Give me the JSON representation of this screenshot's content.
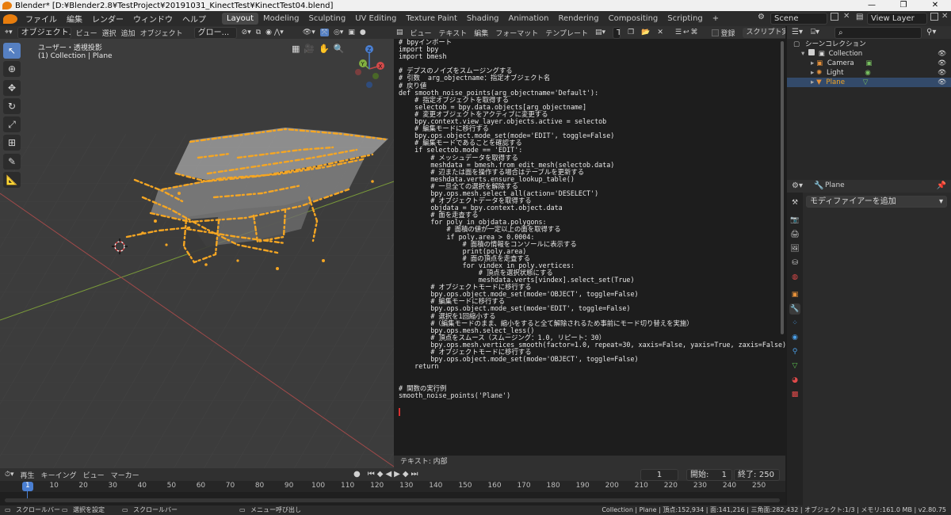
{
  "window": {
    "title": "Blender* [D:¥Blender2.8¥TestProject¥20191031_KinectTest¥KinectTest04.blend]",
    "controls": [
      "—",
      "❐",
      "✕"
    ]
  },
  "menubar": {
    "menus": [
      "ファイル",
      "編集",
      "レンダー",
      "ウィンドウ",
      "ヘルプ"
    ],
    "workspaces": [
      "Layout",
      "Modeling",
      "Sculpting",
      "UV Editing",
      "Texture Paint",
      "Shading",
      "Animation",
      "Rendering",
      "Compositing",
      "Scripting"
    ],
    "active_workspace": "Layout",
    "add_tab": "+",
    "scene": "Scene",
    "view_layer": "View Layer"
  },
  "viewport": {
    "mode": "オブジェクト...",
    "menus": [
      "ビュー",
      "選択",
      "追加",
      "オブジェクト"
    ],
    "transform": "グロー...",
    "view_name": "ユーザー・透視投影",
    "collection_info": "(1) Collection | Plane",
    "gizmo_axes": [
      "X",
      "Y",
      "Z"
    ]
  },
  "text_editor": {
    "menus": [
      "ビュー",
      "テキスト",
      "編集",
      "フォーマット",
      "テンプレート"
    ],
    "text_name": "Text",
    "register_label": "登録",
    "run_script": "スクリプト実行",
    "footer": "テキスト: 内部",
    "code_lines": [
      "# bpyインポート",
      "import bpy",
      "import bmesh",
      "",
      "# デプスのノイズをスムージングする",
      "# 引数  arg_objectname：指定オブジェクト名",
      "# 戻り値",
      "def smooth_noise_points(arg_objectname='Default'):",
      "    # 指定オブジェクトを取得する",
      "    selectob = bpy.data.objects[arg_objectname]",
      "    # 変更オブジェクトをアクティブに変更する",
      "    bpy.context.view_layer.objects.active = selectob",
      "    # 編集モードに移行する",
      "    bpy.ops.object.mode_set(mode='EDIT', toggle=False)",
      "    # 編集モードであることを確認する",
      "    if selectob.mode == 'EDIT':",
      "        # メッシュデータを取得する",
      "        meshdata = bmesh.from_edit_mesh(selectob.data)",
      "        # 辺または面を操作する場合はテーブルを更新する",
      "        meshdata.verts.ensure_lookup_table()",
      "        # 一旦全ての選択を解除する",
      "        bpy.ops.mesh.select_all(action='DESELECT')",
      "        # オブジェクトデータを取得する",
      "        objdata = bpy.context.object.data",
      "        # 面を走査する",
      "        for poly in objdata.polygons:",
      "            # 面積の値が一定以上の面を取得する",
      "            if poly.area > 0.0004:",
      "                # 面積の情報をコンソールに表示する",
      "                print(poly.area)",
      "                # 面の頂点を走査する",
      "                for vindex in poly.vertices:",
      "                    # 頂点を選択状態にする",
      "                    meshdata.verts[vindex].select_set(True)",
      "        # オブジェクトモードに移行する",
      "        bpy.ops.object.mode_set(mode='OBJECT', toggle=False)",
      "        # 編集モードに移行する",
      "        bpy.ops.object.mode_set(mode='EDIT', toggle=False)",
      "        # 選択を1回縮小する",
      "        #（編集モードのまま、縮小をすると全て解除されるため事前にモード切り替えを実施）",
      "        bpy.ops.mesh.select_less()",
      "        # 頂点をスムース（スムージング：1.0, リピート：30）",
      "        bpy.ops.mesh.vertices_smooth(factor=1.0, repeat=30, xaxis=False, yaxis=True, zaxis=False)",
      "        # オブジェクトモードに移行する",
      "        bpy.ops.object.mode_set(mode='OBJECT', toggle=False)",
      "    return",
      "",
      "",
      "# 関数の実行例",
      "smooth_noise_points('Plane')"
    ]
  },
  "outliner": {
    "root": "シーンコレクション",
    "collection": "Collection",
    "items": [
      "Camera",
      "Light",
      "Plane"
    ]
  },
  "properties": {
    "object_name": "Plane",
    "add_modifier": "モディファイアーを追加"
  },
  "timeline": {
    "menus": [
      "再生",
      "キーイング",
      "ビュー",
      "マーカー"
    ],
    "current_frame": "1",
    "start_label": "開始:",
    "start": "1",
    "end_label": "終了:",
    "end": "250",
    "ticks": [
      "1",
      "10",
      "20",
      "30",
      "40",
      "50",
      "60",
      "70",
      "80",
      "90",
      "100",
      "110",
      "120",
      "130",
      "140",
      "150",
      "160",
      "170",
      "180",
      "190",
      "200",
      "210",
      "220",
      "230",
      "240",
      "250"
    ]
  },
  "statusbar": {
    "left": [
      "スクロールバー",
      "選択を設定",
      "スクロールバー",
      "メニュー呼び出し"
    ],
    "stats": "Collection | Plane | 頂点:152,934 | 面:141,216 | 三角面:282,432 | オブジェクト:1/3 | メモリ:161.0 MB | v2.80.75"
  },
  "colors": {
    "accent": "#5680c2",
    "selection_orange": "#f5a623",
    "viewport_bg": "#3c3c3c"
  }
}
